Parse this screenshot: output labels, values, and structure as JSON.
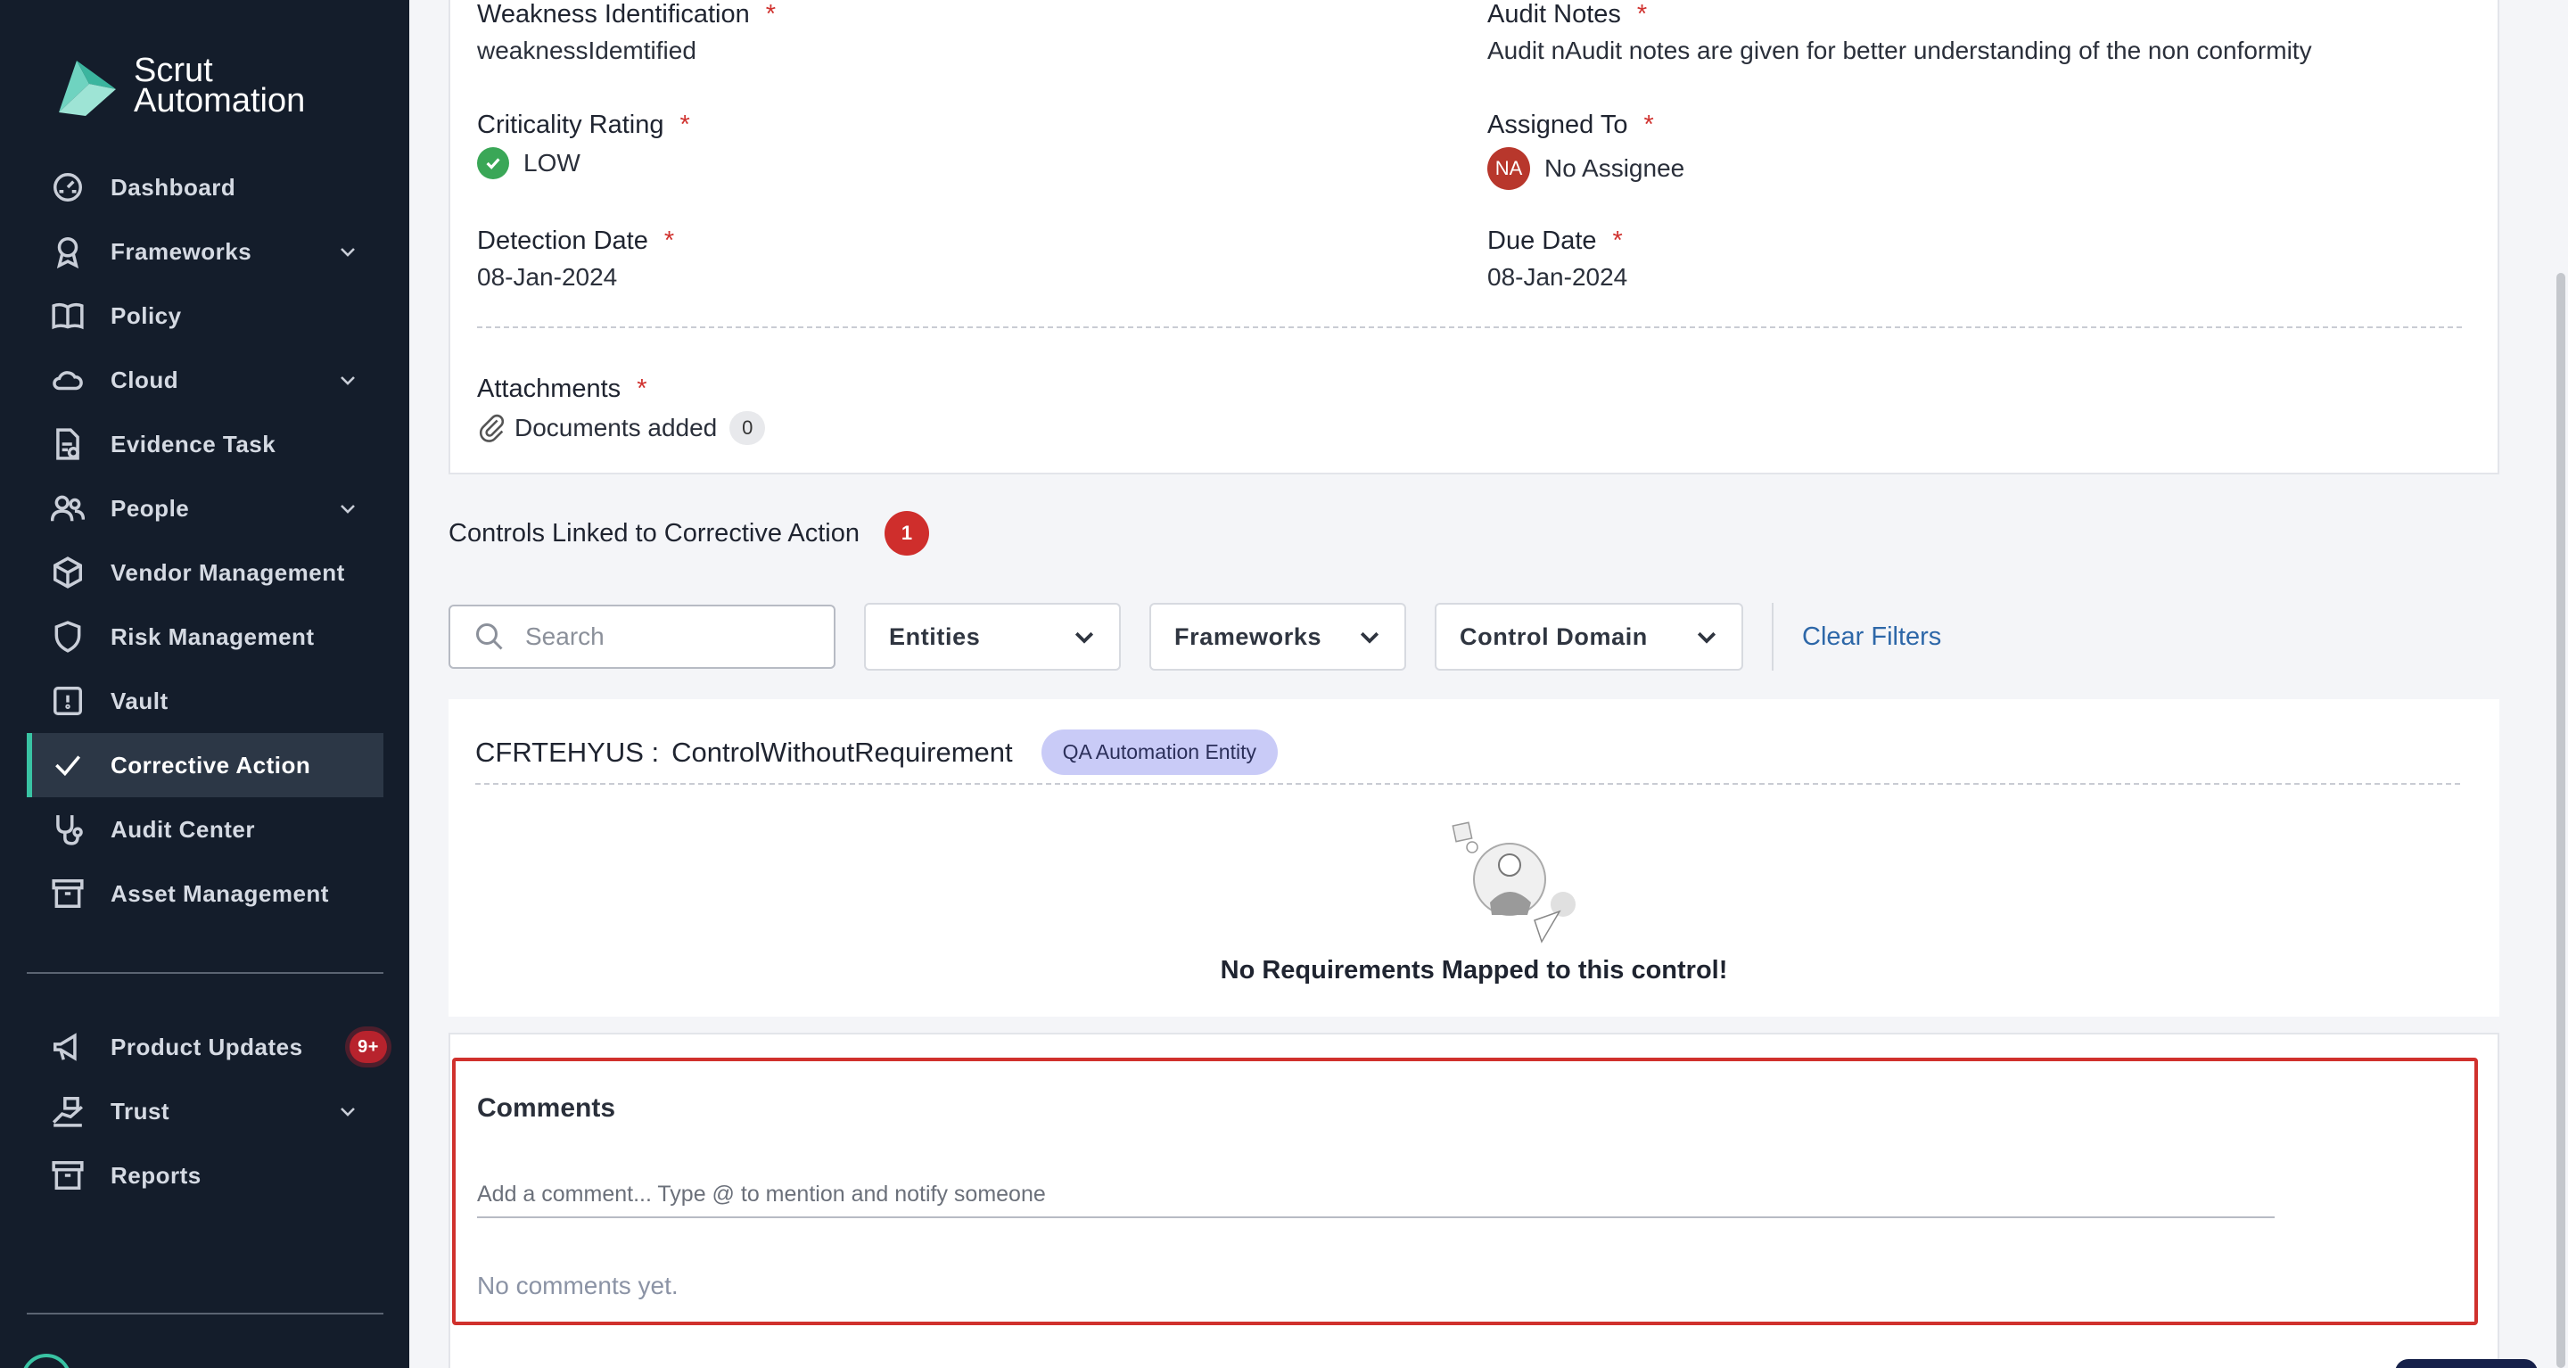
{
  "brand": {
    "line1": "Scrut",
    "line2": "Automation"
  },
  "sidebar": {
    "items": [
      {
        "label": "Dashboard",
        "icon": "dashboard-icon",
        "chevron": false
      },
      {
        "label": "Frameworks",
        "icon": "award-icon",
        "chevron": true
      },
      {
        "label": "Policy",
        "icon": "book-icon",
        "chevron": false
      },
      {
        "label": "Cloud",
        "icon": "cloud-icon",
        "chevron": true
      },
      {
        "label": "Evidence Task",
        "icon": "task-icon",
        "chevron": false
      },
      {
        "label": "People",
        "icon": "people-icon",
        "chevron": true
      },
      {
        "label": "Vendor Management",
        "icon": "box-icon",
        "chevron": false
      },
      {
        "label": "Risk Management",
        "icon": "shield-icon",
        "chevron": false
      },
      {
        "label": "Vault",
        "icon": "vault-icon",
        "chevron": false
      },
      {
        "label": "Corrective Action",
        "icon": "check-icon",
        "chevron": false,
        "active": true
      },
      {
        "label": "Audit Center",
        "icon": "stethoscope-icon",
        "chevron": false
      },
      {
        "label": "Asset Management",
        "icon": "archive-icon",
        "chevron": false
      }
    ],
    "secondary": [
      {
        "label": "Product Updates",
        "icon": "megaphone-icon",
        "badge": "9+"
      },
      {
        "label": "Trust",
        "icon": "trust-icon",
        "chevron": true
      },
      {
        "label": "Reports",
        "icon": "reports-icon"
      }
    ]
  },
  "details": {
    "weakness": {
      "label": "Weakness Identification",
      "value": "weaknessIdemtified"
    },
    "audit_notes": {
      "label": "Audit Notes",
      "value": "Audit nAudit notes are given for better understanding of the non conformity"
    },
    "criticality": {
      "label": "Criticality Rating",
      "value": "LOW"
    },
    "assigned_to": {
      "label": "Assigned To",
      "initials": "NA",
      "value": "No Assignee"
    },
    "detection_date": {
      "label": "Detection Date",
      "value": "08-Jan-2024"
    },
    "due_date": {
      "label": "Due Date",
      "value": "08-Jan-2024"
    },
    "attachments": {
      "label": "Attachments",
      "value": "Documents added",
      "count": "0"
    },
    "required_mark": "*"
  },
  "controls": {
    "title": "Controls Linked to Corrective Action",
    "count": "1",
    "search_placeholder": "Search",
    "filters": [
      "Entities",
      "Frameworks",
      "Control Domain"
    ],
    "clear_filters": "Clear Filters",
    "control_id": "CFRTEHYUS :",
    "control_name": "ControlWithoutRequirement",
    "entity_chip": "QA Automation Entity",
    "empty_message": "No Requirements Mapped to this control!"
  },
  "comments": {
    "title": "Comments",
    "placeholder": "Add a comment... Type @ to mention and notify someone",
    "empty": "No comments yet."
  },
  "colors": {
    "sidebar_bg": "#141d2b",
    "accent": "#39c3a3",
    "danger": "#d0312d",
    "link": "#2d67a8"
  }
}
